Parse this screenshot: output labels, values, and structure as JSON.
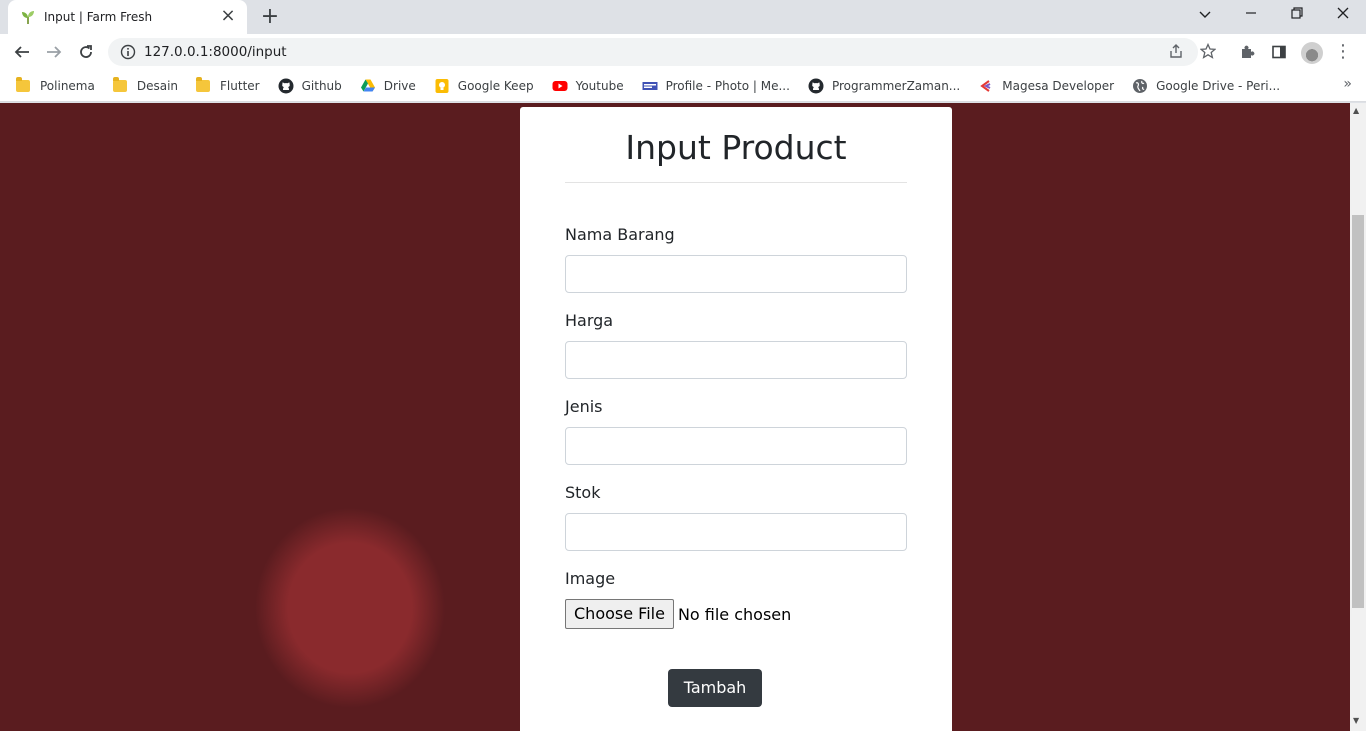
{
  "browser": {
    "tab_title": "Input | Farm Fresh",
    "url": "127.0.0.1:8000/input",
    "bookmarks": [
      {
        "label": "Polinema",
        "icon": "folder-icon"
      },
      {
        "label": "Desain",
        "icon": "folder-icon"
      },
      {
        "label": "Flutter",
        "icon": "folder-icon"
      },
      {
        "label": "Github",
        "icon": "github-icon"
      },
      {
        "label": "Drive",
        "icon": "google-drive-icon"
      },
      {
        "label": "Google Keep",
        "icon": "google-keep-icon"
      },
      {
        "label": "Youtube",
        "icon": "youtube-icon"
      },
      {
        "label": "Profile - Photo | Me...",
        "icon": "profile-icon"
      },
      {
        "label": "ProgrammerZaman...",
        "icon": "github-icon"
      },
      {
        "label": "Magesa Developer",
        "icon": "magesa-icon"
      },
      {
        "label": "Google Drive - Peri...",
        "icon": "globe-icon"
      }
    ]
  },
  "form": {
    "title": "Input Product",
    "fields": [
      {
        "label": "Nama Barang",
        "value": ""
      },
      {
        "label": "Harga",
        "value": ""
      },
      {
        "label": "Jenis",
        "value": ""
      },
      {
        "label": "Stok",
        "value": ""
      }
    ],
    "image_label": "Image",
    "file_button": "Choose File",
    "file_status": "No file chosen",
    "submit_label": "Tambah"
  },
  "colors": {
    "submit_bg": "#343a40",
    "card_bg": "#ffffff",
    "chrome_bg": "#dee1e6"
  }
}
